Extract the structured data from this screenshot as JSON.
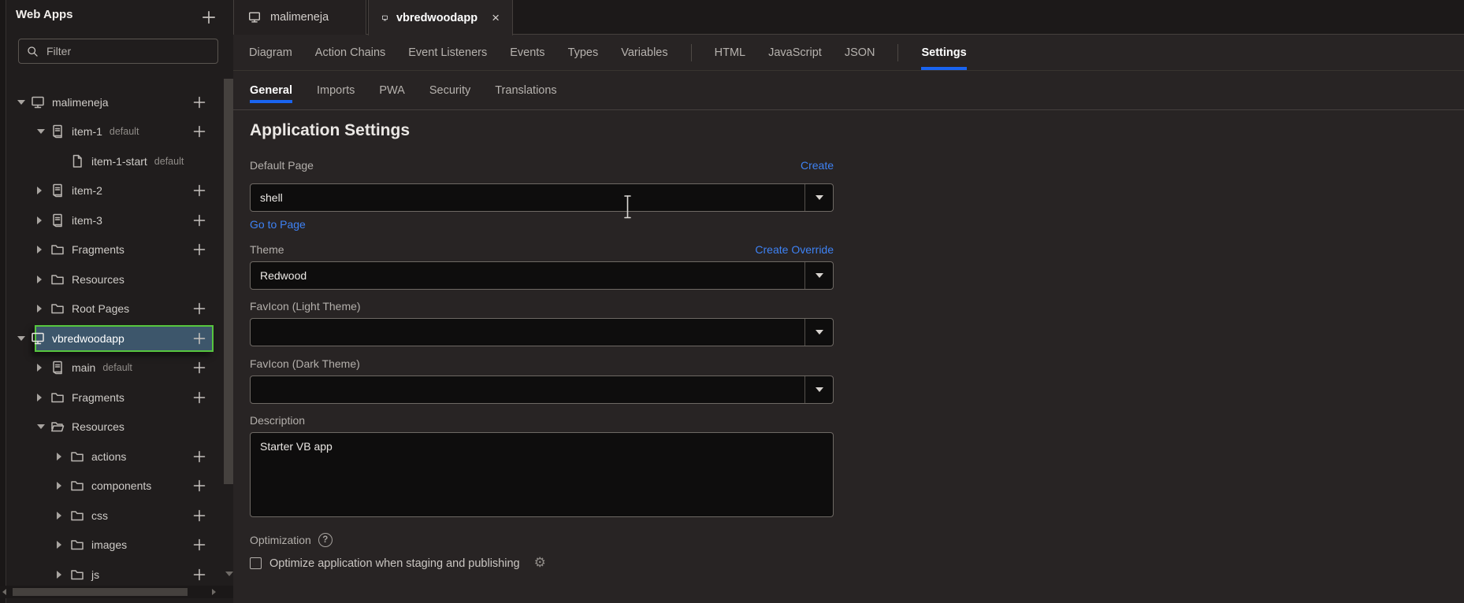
{
  "sidebar": {
    "title": "Web Apps",
    "filter_placeholder": "Filter",
    "tree": [
      {
        "label": "malimeneja",
        "badge": "",
        "level": 0,
        "icon": "monitor",
        "chevron": "down",
        "add": true,
        "selected": false
      },
      {
        "label": "item-1",
        "badge": "default",
        "level": 1,
        "icon": "page-copy",
        "chevron": "down",
        "add": true,
        "selected": false
      },
      {
        "label": "item-1-start",
        "badge": "default",
        "level": 2,
        "icon": "page",
        "chevron": "none",
        "add": false,
        "selected": false
      },
      {
        "label": "item-2",
        "badge": "",
        "level": 1,
        "icon": "page-copy",
        "chevron": "right",
        "add": true,
        "selected": false
      },
      {
        "label": "item-3",
        "badge": "",
        "level": 1,
        "icon": "page-copy",
        "chevron": "right",
        "add": true,
        "selected": false
      },
      {
        "label": "Fragments",
        "badge": "",
        "level": 1,
        "icon": "folder",
        "chevron": "right",
        "add": true,
        "selected": false
      },
      {
        "label": "Resources",
        "badge": "",
        "level": 1,
        "icon": "folder",
        "chevron": "right",
        "add": false,
        "selected": false
      },
      {
        "label": "Root Pages",
        "badge": "",
        "level": 1,
        "icon": "folder",
        "chevron": "right",
        "add": true,
        "selected": false
      },
      {
        "label": "vbredwoodapp",
        "badge": "",
        "level": 0,
        "icon": "monitor",
        "chevron": "down",
        "add": true,
        "selected": true
      },
      {
        "label": "main",
        "badge": "default",
        "level": 1,
        "icon": "page-copy",
        "chevron": "right",
        "add": true,
        "selected": false
      },
      {
        "label": "Fragments",
        "badge": "",
        "level": 1,
        "icon": "folder",
        "chevron": "right",
        "add": true,
        "selected": false
      },
      {
        "label": "Resources",
        "badge": "",
        "level": 1,
        "icon": "folder-open",
        "chevron": "down",
        "add": false,
        "selected": false
      },
      {
        "label": "actions",
        "badge": "",
        "level": 2,
        "icon": "folder",
        "chevron": "right",
        "add": true,
        "selected": false
      },
      {
        "label": "components",
        "badge": "",
        "level": 2,
        "icon": "folder",
        "chevron": "right",
        "add": true,
        "selected": false
      },
      {
        "label": "css",
        "badge": "",
        "level": 2,
        "icon": "folder",
        "chevron": "right",
        "add": true,
        "selected": false
      },
      {
        "label": "images",
        "badge": "",
        "level": 2,
        "icon": "folder",
        "chevron": "right",
        "add": true,
        "selected": false
      },
      {
        "label": "js",
        "badge": "",
        "level": 2,
        "icon": "folder",
        "chevron": "right",
        "add": true,
        "selected": false
      }
    ]
  },
  "editor_tabs": [
    {
      "label": "malimeneja",
      "icon": "monitor-icon",
      "active": false,
      "closable": false
    },
    {
      "label": "vbredwoodapp",
      "icon": "monitor-icon",
      "active": true,
      "closable": true,
      "close_glyph": "×"
    }
  ],
  "nav_tabs": [
    {
      "label": "Diagram",
      "active": false,
      "divider_after": false
    },
    {
      "label": "Action Chains",
      "active": false,
      "divider_after": false
    },
    {
      "label": "Event Listeners",
      "active": false,
      "divider_after": false
    },
    {
      "label": "Events",
      "active": false,
      "divider_after": false
    },
    {
      "label": "Types",
      "active": false,
      "divider_after": false
    },
    {
      "label": "Variables",
      "active": false,
      "divider_after": true
    },
    {
      "label": "HTML",
      "active": false,
      "divider_after": false
    },
    {
      "label": "JavaScript",
      "active": false,
      "divider_after": false
    },
    {
      "label": "JSON",
      "active": false,
      "divider_after": true
    },
    {
      "label": "Settings",
      "active": true,
      "divider_after": false
    }
  ],
  "sub_tabs": [
    {
      "label": "General",
      "active": true
    },
    {
      "label": "Imports",
      "active": false
    },
    {
      "label": "PWA",
      "active": false
    },
    {
      "label": "Security",
      "active": false
    },
    {
      "label": "Translations",
      "active": false
    }
  ],
  "settings": {
    "heading": "Application Settings",
    "default_page": {
      "label": "Default Page",
      "value": "shell",
      "create_label": "Create",
      "goto_label": "Go to Page"
    },
    "theme": {
      "label": "Theme",
      "value": "Redwood",
      "create_label": "Create Override"
    },
    "favicon_light": {
      "label": "FavIcon (Light Theme)",
      "value": ""
    },
    "favicon_dark": {
      "label": "FavIcon (Dark Theme)",
      "value": ""
    },
    "description": {
      "label": "Description",
      "value": "Starter VB app"
    },
    "optimization": {
      "label": "Optimization",
      "help_glyph": "?",
      "checkbox_label": "Optimize application when staging and publishing",
      "checkbox_checked": false,
      "gear_glyph": "⚙"
    }
  },
  "colors": {
    "accent_underline_blue": "#1a64f0",
    "link_blue": "#3e82f4",
    "selection_green": "#57c63e",
    "selected_row_bg": "#3d566b",
    "sidebar_bg": "#201d1d",
    "main_bg": "#282424",
    "input_bg": "#0e0d0d"
  }
}
